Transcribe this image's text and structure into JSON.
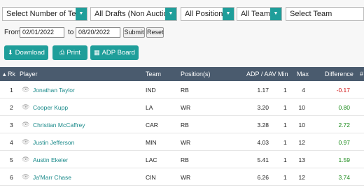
{
  "filters": {
    "teams_count": "Select Number of Teams",
    "drafts": "All Drafts (Non Auction)",
    "positions": "All Positions",
    "teams": "All Teams",
    "team": "Select Team"
  },
  "dates": {
    "from_label": "From",
    "from_value": "02/01/2022",
    "to_label": "to",
    "to_value": "08/20/2022",
    "submit": "Submit",
    "reset": "Reset"
  },
  "actions": {
    "download": "Download",
    "print": "Print",
    "adp_board": "ADP Board"
  },
  "table": {
    "headers": {
      "rk": "▴ Rk",
      "player": "Player",
      "team": "Team",
      "position": "Position(s)",
      "adp": "ADP / AAV",
      "min": "Min",
      "max": "Max",
      "difference": "Difference",
      "extra": "#"
    },
    "rows": [
      {
        "rk": "1",
        "player": "Jonathan Taylor",
        "team": "IND",
        "pos": "RB",
        "adp": "1.17",
        "min": "1",
        "max": "4",
        "diff": "-0.17",
        "diff_sign": "neg"
      },
      {
        "rk": "2",
        "player": "Cooper Kupp",
        "team": "LA",
        "pos": "WR",
        "adp": "3.20",
        "min": "1",
        "max": "10",
        "diff": "0.80",
        "diff_sign": "pos"
      },
      {
        "rk": "3",
        "player": "Christian McCaffrey",
        "team": "CAR",
        "pos": "RB",
        "adp": "3.28",
        "min": "1",
        "max": "10",
        "diff": "2.72",
        "diff_sign": "pos"
      },
      {
        "rk": "4",
        "player": "Justin Jefferson",
        "team": "MIN",
        "pos": "WR",
        "adp": "4.03",
        "min": "1",
        "max": "12",
        "diff": "0.97",
        "diff_sign": "pos"
      },
      {
        "rk": "5",
        "player": "Austin Ekeler",
        "team": "LAC",
        "pos": "RB",
        "adp": "5.41",
        "min": "1",
        "max": "13",
        "diff": "1.59",
        "diff_sign": "pos"
      },
      {
        "rk": "6",
        "player": "Ja'Marr Chase",
        "team": "CIN",
        "pos": "WR",
        "adp": "6.26",
        "min": "1",
        "max": "12",
        "diff": "3.74",
        "diff_sign": "pos"
      }
    ]
  },
  "colors": {
    "accent": "#1f9e9a",
    "header_bg": "#4a5b6e",
    "positive": "#1a8a1a",
    "negative": "#d01010"
  }
}
